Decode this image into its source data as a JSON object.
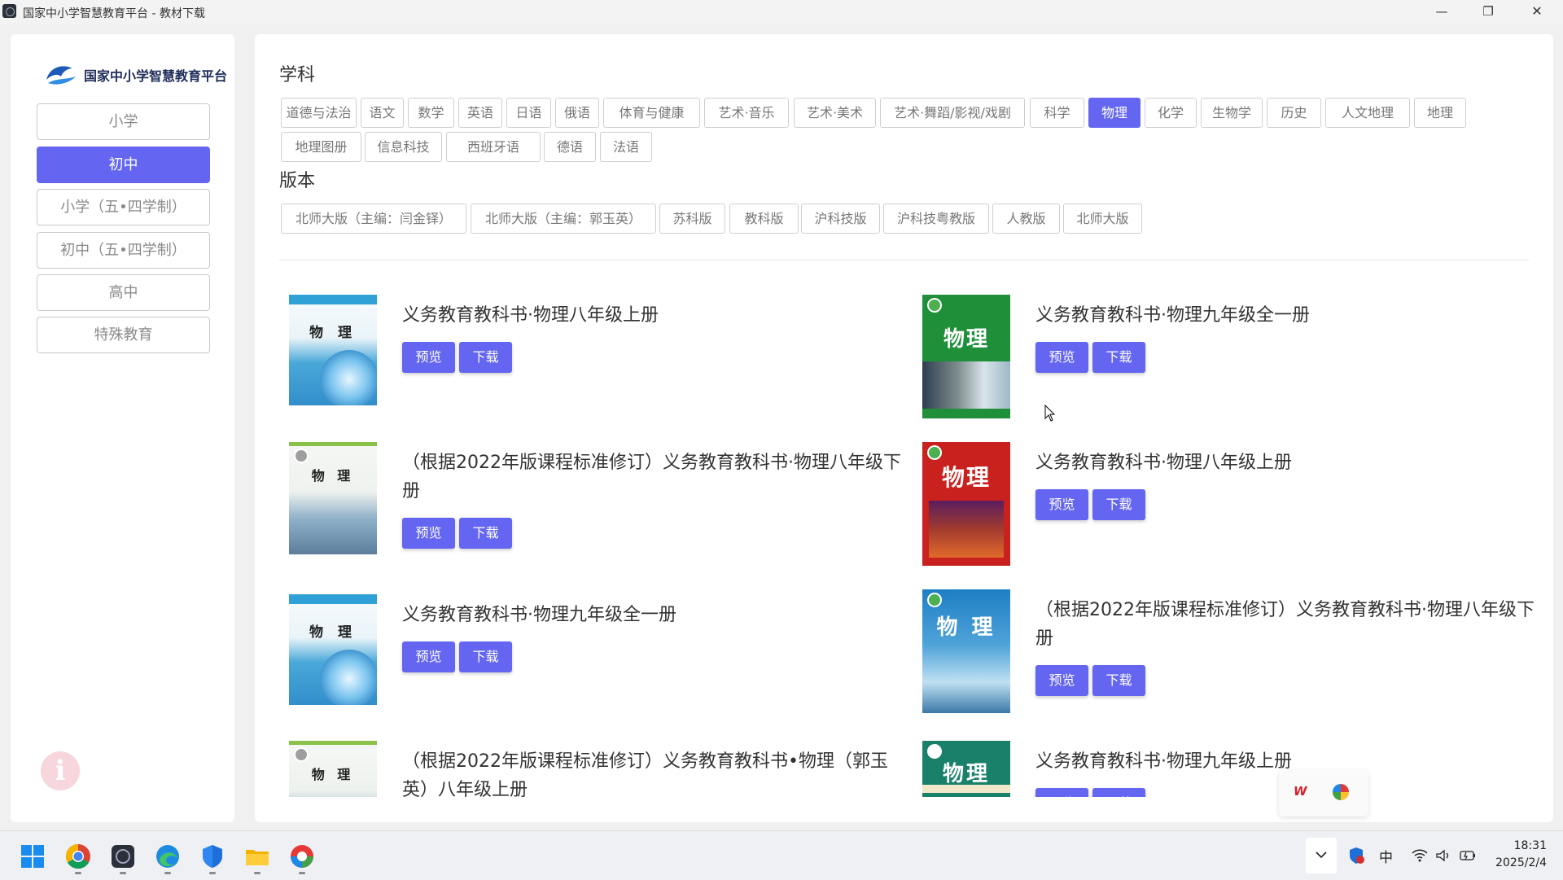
{
  "window": {
    "title": "国家中小学智慧教育平台 - 教材下载"
  },
  "sidebar": {
    "logo_text": "国家中小学智慧教育平台",
    "items": [
      {
        "label": "小学"
      },
      {
        "label": "初中",
        "active": true
      },
      {
        "label": "小学（五•四学制）"
      },
      {
        "label": "初中（五•四学制）"
      },
      {
        "label": "高中"
      },
      {
        "label": "特殊教育"
      }
    ],
    "info_label": "i"
  },
  "subjects": {
    "title": "学科",
    "selected": "物理",
    "items": [
      "道德与法治",
      "语文",
      "数学",
      "英语",
      "日语",
      "俄语",
      "体育与健康",
      "艺术·音乐",
      "艺术·美术",
      "艺术·舞蹈/影视/戏剧",
      "科学",
      "物理",
      "化学",
      "生物学",
      "历史",
      "人文地理",
      "地理",
      "地理图册",
      "信息科技",
      "西班牙语",
      "德语",
      "法语"
    ]
  },
  "editions": {
    "title": "版本",
    "items": [
      "北师大版（主编：闫金铎）",
      "北师大版（主编：郭玉英）",
      "苏科版",
      "教科版",
      "沪科技版",
      "沪科技粤教版",
      "人教版",
      "北师大版"
    ]
  },
  "books": [
    {
      "title": "义务教育教科书·物理八年级上册",
      "cover": {
        "type": "light",
        "text": "物 理"
      }
    },
    {
      "title": "义务教育教科书·物理九年级全一册",
      "cover": {
        "type": "green",
        "text": "物理"
      }
    },
    {
      "title": "（根据2022年版课程标准修订）义务教育教科书·物理八年级下册",
      "cover": {
        "type": "bridge",
        "text": "物 理"
      }
    },
    {
      "title": "义务教育教科书·物理八年级上册",
      "cover": {
        "type": "red",
        "text": "物理"
      }
    },
    {
      "title": "义务教育教科书·物理九年级全一册",
      "cover": {
        "type": "light",
        "text": "物 理"
      }
    },
    {
      "title": "（根据2022年版课程标准修订）义务教育教科书·物理八年级下册",
      "cover": {
        "type": "blue",
        "text": "物 理"
      }
    },
    {
      "title": "（根据2022年版课程标准修订）义务教育教科书•物理（郭玉英）八年级上册",
      "cover": {
        "type": "bridge",
        "text": "物 理"
      }
    },
    {
      "title": "义务教育教科书·物理九年级上册",
      "cover": {
        "type": "teal",
        "text": "物理"
      }
    }
  ],
  "buttons": {
    "preview": "预览",
    "download": "下载"
  },
  "taskbar": {
    "ime": "中",
    "time": "18:31",
    "date": "2025/2/4"
  },
  "colors": {
    "accent": "#6466f1"
  }
}
